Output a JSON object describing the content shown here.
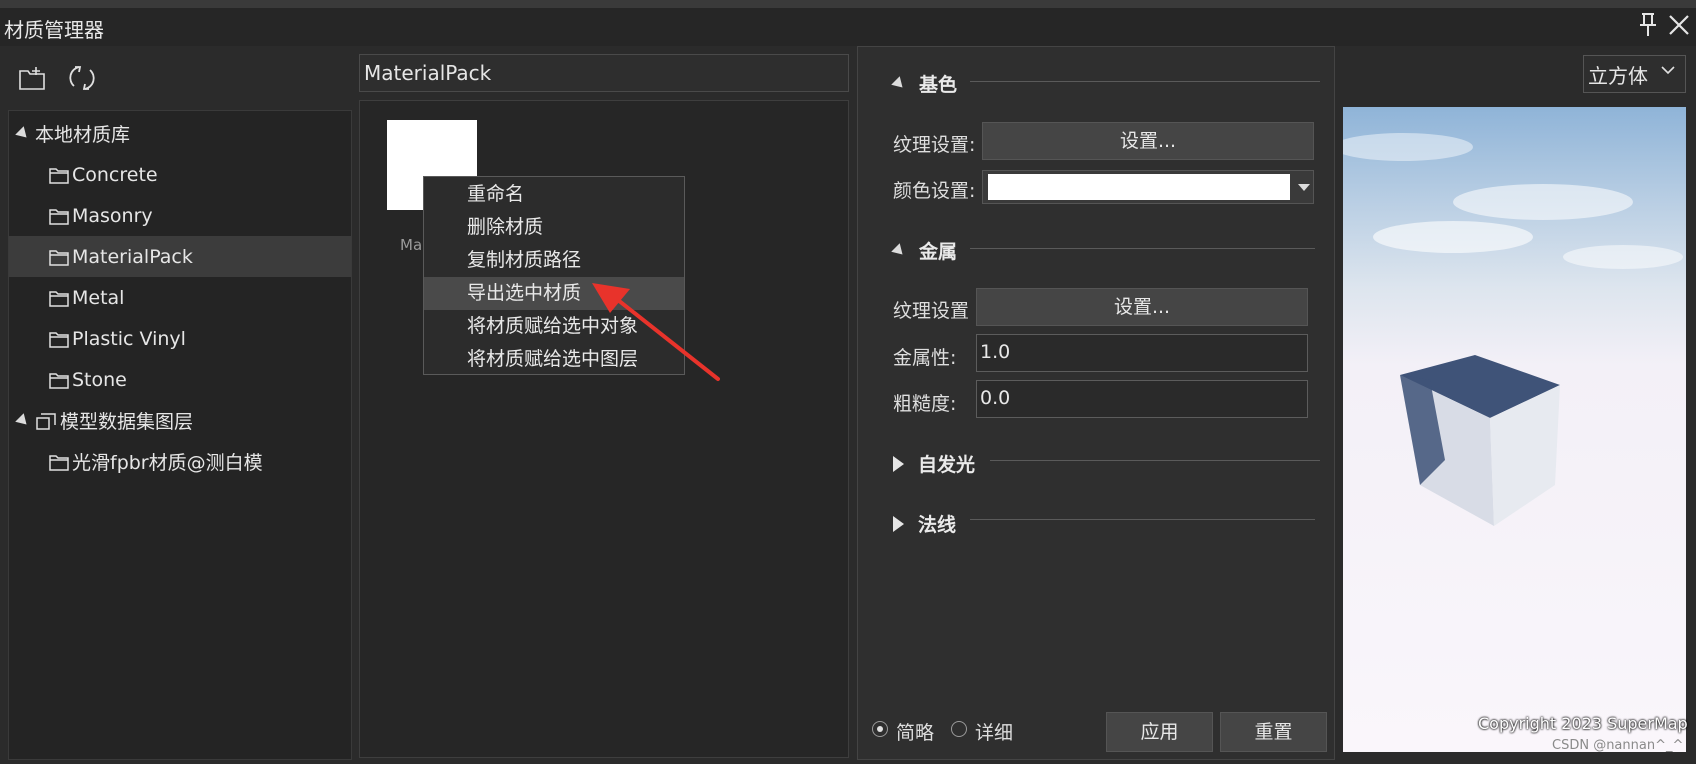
{
  "window": {
    "title": "材质管理器"
  },
  "tree": {
    "items": [
      {
        "label": "本地材质库"
      },
      {
        "label": "Concrete"
      },
      {
        "label": "Masonry"
      },
      {
        "label": "MaterialPack"
      },
      {
        "label": "Metal"
      },
      {
        "label": "Plastic Vinyl"
      },
      {
        "label": "Stone"
      },
      {
        "label": "模型数据集图层"
      },
      {
        "label": "光滑fpbr材质@测白模"
      }
    ]
  },
  "middle": {
    "path": "MaterialPack",
    "thumb_label": "Ma"
  },
  "context_menu": {
    "items": [
      {
        "label": "重命名"
      },
      {
        "label": "删除材质"
      },
      {
        "label": "复制材质路径"
      },
      {
        "label": "导出选中材质"
      },
      {
        "label": "将材质赋给选中对象"
      },
      {
        "label": "将材质赋给选中图层"
      }
    ]
  },
  "props": {
    "base": {
      "title": "基色",
      "texture_label": "纹理设置:",
      "texture_button": "设置...",
      "color_label": "颜色设置:",
      "color_value": "#ffffff"
    },
    "metal": {
      "title": "金属",
      "texture_label": "纹理设置",
      "texture_button": "设置...",
      "metallic_label": "金属性:",
      "metallic_value": "1.0",
      "roughness_label": "粗糙度:",
      "roughness_value": "0.0"
    },
    "emissive": {
      "title": "自发光"
    },
    "normal": {
      "title": "法线"
    },
    "mode": {
      "simple": "简略",
      "detail": "详细",
      "selected": "简略"
    },
    "apply_button": "应用",
    "reset_button": "重置"
  },
  "preview": {
    "shape": "立方体",
    "copyright": "Copyright 2023 SuperMap",
    "watermark": "CSDN @nannan^_^"
  },
  "colors": {
    "bg": "#2b2b2b",
    "panel": "#242424",
    "selection": "#3c3c3c",
    "menu_highlight": "#4a4a4a",
    "arrow": "#e8332b"
  }
}
